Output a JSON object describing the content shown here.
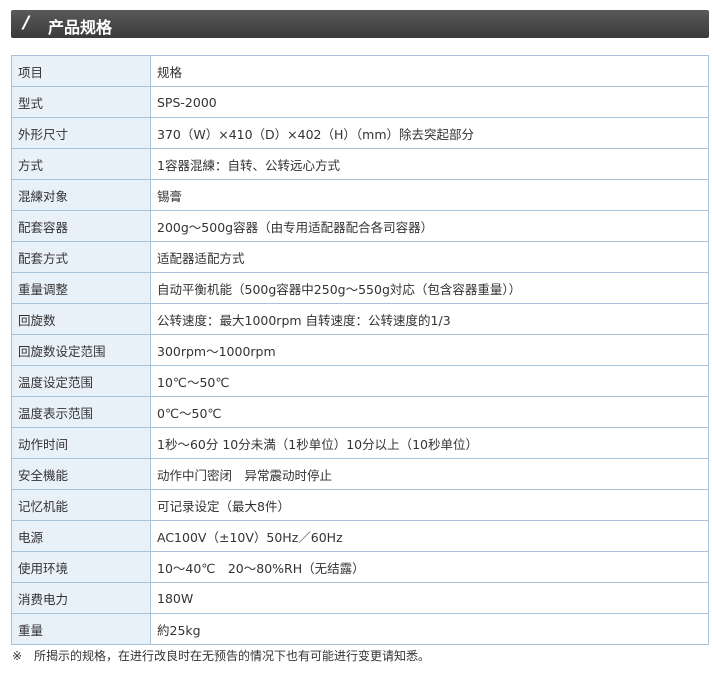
{
  "header": {
    "title": "产品规格",
    "icon": "double-slash-icon"
  },
  "spec_table": {
    "rows": [
      {
        "label": "项目",
        "value": "规格"
      },
      {
        "label": "型式",
        "value": "SPS-2000"
      },
      {
        "label": "外形尺寸",
        "value": "370（W）×410（D）×402（H）（mm）除去突起部分"
      },
      {
        "label": "方式",
        "value": "1容器混練：自转、公转远心方式"
      },
      {
        "label": "混練对象",
        "value": "锡膏"
      },
      {
        "label": "配套容器",
        "value": "200g～500g容器（由专用适配器配合各司容器）"
      },
      {
        "label": "配套方式",
        "value": "适配器适配方式"
      },
      {
        "label": "重量调整",
        "value": "自动平衡机能（500g容器中250g～550g対応（包含容器重量））"
      },
      {
        "label": "回旋数",
        "value": "公转速度：最大1000rpm 自转速度：公转速度的1/3"
      },
      {
        "label": "回旋数设定范围",
        "value": "300rpm～1000rpm"
      },
      {
        "label": "温度设定范围",
        "value": "10℃～50℃"
      },
      {
        "label": "温度表示范围",
        "value": "0℃～50℃"
      },
      {
        "label": "动作时间",
        "value": "1秒～60分 10分未満（1秒单位）10分以上（10秒单位）"
      },
      {
        "label": "安全機能",
        "value": "动作中门密闭　异常震动时停止"
      },
      {
        "label": "记忆机能",
        "value": "可记录设定（最大8件）"
      },
      {
        "label": "电源",
        "value": "AC100V（±10V）50Hz／60Hz"
      },
      {
        "label": "使用环境",
        "value": "10～40℃　20～80%RH（无结露）"
      },
      {
        "label": "消费电力",
        "value": "180W"
      },
      {
        "label": "重量",
        "value": "約25kg"
      }
    ]
  },
  "note": "※　所揭示的规格，在进行改良时在无预告的情况下也有可能进行变更请知悉。",
  "colors": {
    "header_bg": "#444444",
    "label_bg": "#e8f0f8",
    "border": "#a9c3dc"
  }
}
